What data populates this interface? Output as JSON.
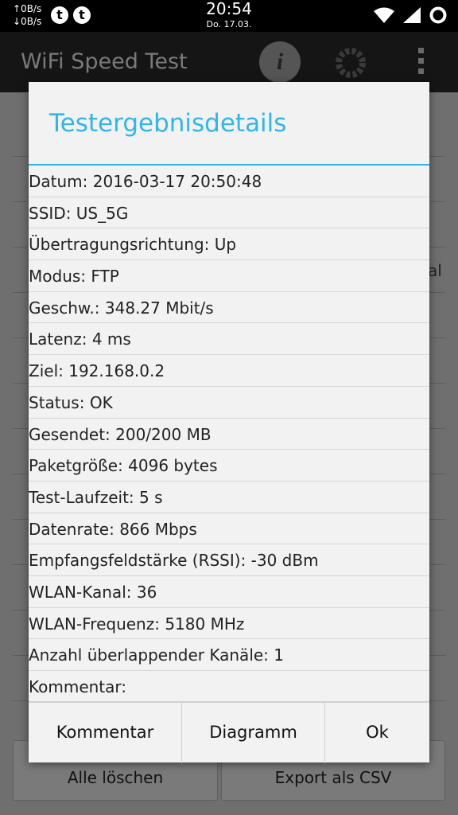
{
  "status_bar": {
    "upload_speed": "↑0B/s",
    "download_speed": "↓0B/s",
    "notification_icons": [
      "t",
      "t"
    ],
    "time": "20:54",
    "date": "Do. 17.03."
  },
  "app_bar": {
    "title": "WiFi Speed Test",
    "info_icon": "i"
  },
  "background": {
    "partial_text": "al",
    "buttons": {
      "clear_all": "Alle löschen",
      "export_csv": "Export als CSV"
    }
  },
  "dialog": {
    "title": "Testergebnisdetails",
    "accent_color": "#33b5e5",
    "rows": [
      "Datum: 2016-03-17 20:50:48",
      "SSID: US_5G",
      "Übertragungsrichtung: Up",
      "Modus: FTP",
      "Geschw.: 348.27 Mbit/s",
      "Latenz: 4 ms",
      "Ziel: 192.168.0.2",
      "Status: OK",
      "Gesendet: 200/200 MB",
      "Paketgröße: 4096 bytes",
      "Test-Laufzeit: 5 s",
      "Datenrate: 866 Mbps",
      "Empfangsfeldstärke (RSSI): -30 dBm",
      "WLAN-Kanal: 36",
      "WLAN-Frequenz: 5180 MHz",
      "Anzahl überlappender Kanäle: 1",
      "Kommentar:"
    ],
    "buttons": {
      "comment": "Kommentar",
      "chart": "Diagramm",
      "ok": "Ok"
    }
  }
}
